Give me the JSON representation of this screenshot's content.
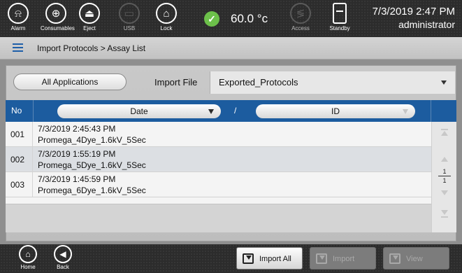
{
  "topbar": {
    "buttons": [
      {
        "label": "Alarm",
        "icon": "bell-icon",
        "glyph": "⍾",
        "enabled": true
      },
      {
        "label": "Consumables",
        "icon": "consumables-icon",
        "glyph": "⊕",
        "enabled": true
      },
      {
        "label": "Eject",
        "icon": "eject-icon",
        "glyph": "⏏",
        "enabled": true
      },
      {
        "label": "USB",
        "icon": "usb-icon",
        "glyph": "▭",
        "enabled": false
      },
      {
        "label": "Lock",
        "icon": "lock-icon",
        "glyph": "⌂",
        "enabled": true
      },
      {
        "label": "Access",
        "icon": "share-icon",
        "glyph": "≶",
        "enabled": false
      },
      {
        "label": "Standby",
        "icon": "standby-icon",
        "glyph": "",
        "enabled": true
      }
    ],
    "temperature": "60.0 °c",
    "temperature_status_icon": "check-icon",
    "datetime": "7/3/2019 2:47 PM",
    "user": "administrator"
  },
  "breadcrumb": {
    "icon": "menu-icon",
    "text": "Import Protocols > Assay List"
  },
  "filters": {
    "applications_label": "All Applications",
    "import_file_label": "Import File",
    "import_file_value": "Exported_Protocols"
  },
  "table": {
    "columns": {
      "no": "No",
      "date": "Date",
      "separator": "/",
      "id": "ID"
    },
    "rows": [
      {
        "no": "001",
        "date": "7/3/2019 2:45:43 PM",
        "name": "Promega_4Dye_1.6kV_5Sec",
        "selected": false
      },
      {
        "no": "002",
        "date": "7/3/2019 1:55:19 PM",
        "name": "Promega_5Dye_1.6kV_5Sec",
        "selected": true
      },
      {
        "no": "003",
        "date": "7/3/2019 1:45:59 PM",
        "name": "Promega_6Dye_1.6kV_5Sec",
        "selected": false
      }
    ],
    "page_current": "1",
    "page_total": "1"
  },
  "bottombar": {
    "home_label": "Home",
    "back_label": "Back",
    "import_all_label": "Import All",
    "import_label": "Import",
    "view_label": "View"
  }
}
